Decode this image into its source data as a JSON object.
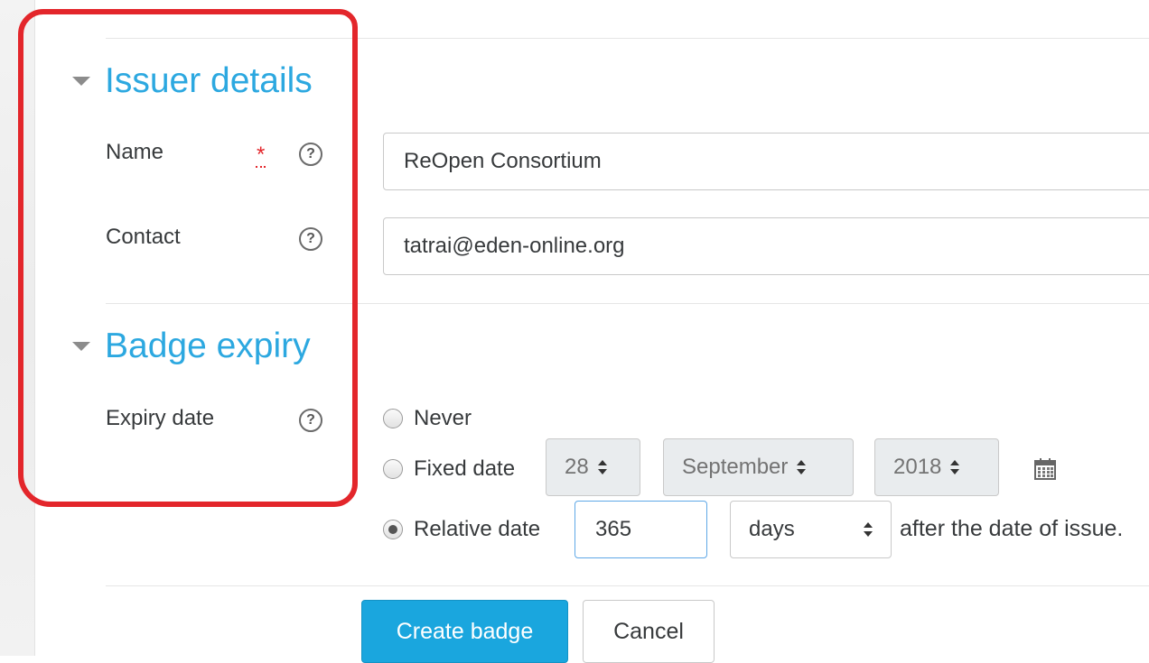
{
  "sections": {
    "issuer": {
      "title": "Issuer details"
    },
    "expiry": {
      "title": "Badge expiry"
    }
  },
  "fields": {
    "name": {
      "label": "Name",
      "value": "ReOpen Consortium",
      "required_marker": "*",
      "help": "?"
    },
    "contact": {
      "label": "Contact",
      "value": "tatrai@eden-online.org",
      "help": "?"
    },
    "expiry_date": {
      "label": "Expiry date",
      "help": "?",
      "options": {
        "never": "Never",
        "fixed": "Fixed date",
        "relative": "Relative date"
      },
      "selected": "relative",
      "fixed_day": "28",
      "fixed_month": "September",
      "fixed_year": "2018",
      "relative_value": "365",
      "relative_unit": "days",
      "relative_suffix": "after the date of issue."
    }
  },
  "buttons": {
    "create": "Create badge",
    "cancel": "Cancel"
  },
  "colors": {
    "accent": "#2ca8e0",
    "primary_button": "#1aa6de",
    "required": "#e3262b",
    "annotation_box": "#e3262b"
  },
  "icons": {
    "section_toggle": "caret-down-icon",
    "help": "question-circle-icon",
    "calendar": "calendar-icon",
    "required": "asterisk-icon"
  }
}
